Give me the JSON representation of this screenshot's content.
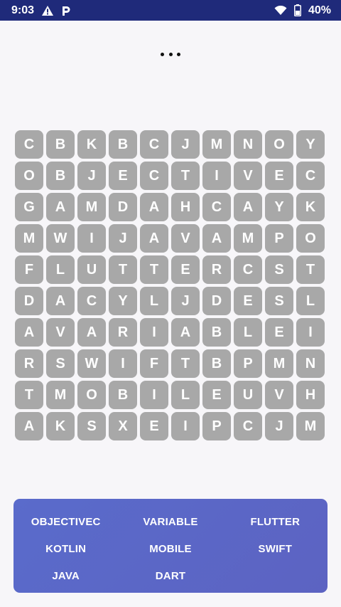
{
  "status_bar": {
    "time": "9:03",
    "battery": "40%",
    "icons": [
      "warning-icon",
      "parking-icon",
      "wifi-icon",
      "battery-icon"
    ]
  },
  "menu": {
    "icon": "more-horiz-icon"
  },
  "grid": {
    "rows": [
      [
        "C",
        "B",
        "K",
        "B",
        "C",
        "J",
        "M",
        "N",
        "O",
        "Y"
      ],
      [
        "O",
        "B",
        "J",
        "E",
        "C",
        "T",
        "I",
        "V",
        "E",
        "C"
      ],
      [
        "G",
        "A",
        "M",
        "D",
        "A",
        "H",
        "C",
        "A",
        "Y",
        "K"
      ],
      [
        "M",
        "W",
        "I",
        "J",
        "A",
        "V",
        "A",
        "M",
        "P",
        "O"
      ],
      [
        "F",
        "L",
        "U",
        "T",
        "T",
        "E",
        "R",
        "C",
        "S",
        "T"
      ],
      [
        "D",
        "A",
        "C",
        "Y",
        "L",
        "J",
        "D",
        "E",
        "S",
        "L"
      ],
      [
        "A",
        "V",
        "A",
        "R",
        "I",
        "A",
        "B",
        "L",
        "E",
        "I"
      ],
      [
        "R",
        "S",
        "W",
        "I",
        "F",
        "T",
        "B",
        "P",
        "M",
        "N"
      ],
      [
        "T",
        "M",
        "O",
        "B",
        "I",
        "L",
        "E",
        "U",
        "V",
        "H"
      ],
      [
        "A",
        "K",
        "S",
        "X",
        "E",
        "I",
        "P",
        "C",
        "J",
        "M"
      ]
    ]
  },
  "words": [
    "OBJECTIVEC",
    "VARIABLE",
    "FLUTTER",
    "KOTLIN",
    "MOBILE",
    "SWIFT",
    "JAVA",
    "DART"
  ],
  "colors": {
    "status_bar": "#1f2a7a",
    "cell": "#a8a8a8",
    "panel": "#5a6bcb",
    "background": "#f7f6f9"
  }
}
